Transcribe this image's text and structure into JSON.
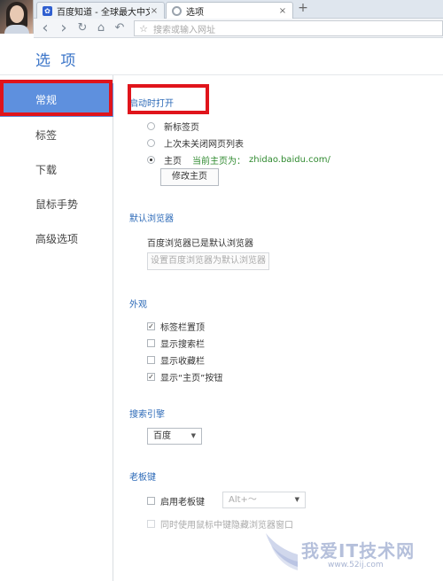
{
  "browser": {
    "tabs": [
      {
        "label": "百度知道 - 全球最大中文互",
        "close": "×"
      },
      {
        "label": "选项",
        "close": "×"
      }
    ],
    "new_tab": "+",
    "nav": {
      "back": "‹",
      "forward": "›",
      "refresh": "↻",
      "home": "⌂",
      "undo": "↶"
    },
    "address_placeholder": "搜索或输入网址"
  },
  "page": {
    "title": "选 项"
  },
  "sidebar": {
    "items": [
      {
        "label": "常规",
        "active": true
      },
      {
        "label": "标签"
      },
      {
        "label": "下载"
      },
      {
        "label": "鼠标手势"
      },
      {
        "label": "高级选项"
      }
    ]
  },
  "startup": {
    "title": "启动时打开",
    "options": [
      "新标签页",
      "上次未关闭网页列表",
      "主页"
    ],
    "selected": "主页",
    "current_homepage_label": "当前主页为：",
    "current_homepage_value": "zhidao.baidu.com/",
    "modify_button": "修改主页"
  },
  "default_browser": {
    "title": "默认浏览器",
    "status": "百度浏览器已是默认浏览器",
    "set_button": "设置百度浏览器为默认浏览器"
  },
  "appearance": {
    "title": "外观",
    "options": [
      {
        "label": "标签栏置顶",
        "checked": true
      },
      {
        "label": "显示搜索栏",
        "checked": false
      },
      {
        "label": "显示收藏栏",
        "checked": false
      },
      {
        "label": "显示“主页”按钮",
        "checked": true
      }
    ]
  },
  "search_engine": {
    "title": "搜索引擎",
    "selected": "百度"
  },
  "boss_key": {
    "title": "老板键",
    "enable_label": "启用老板键",
    "enabled": false,
    "key_value": "Alt+～",
    "middle_click_label": "同时使用鼠标中键隐藏浏览器窗口"
  },
  "watermark": {
    "text": "我爱IT技术网",
    "url": "www.52ij.com"
  },
  "colors": {
    "accent": "#3a74c8",
    "active_item": "#5e90de",
    "highlight": "#e0141b",
    "homepage_text": "#2f8a2f"
  }
}
